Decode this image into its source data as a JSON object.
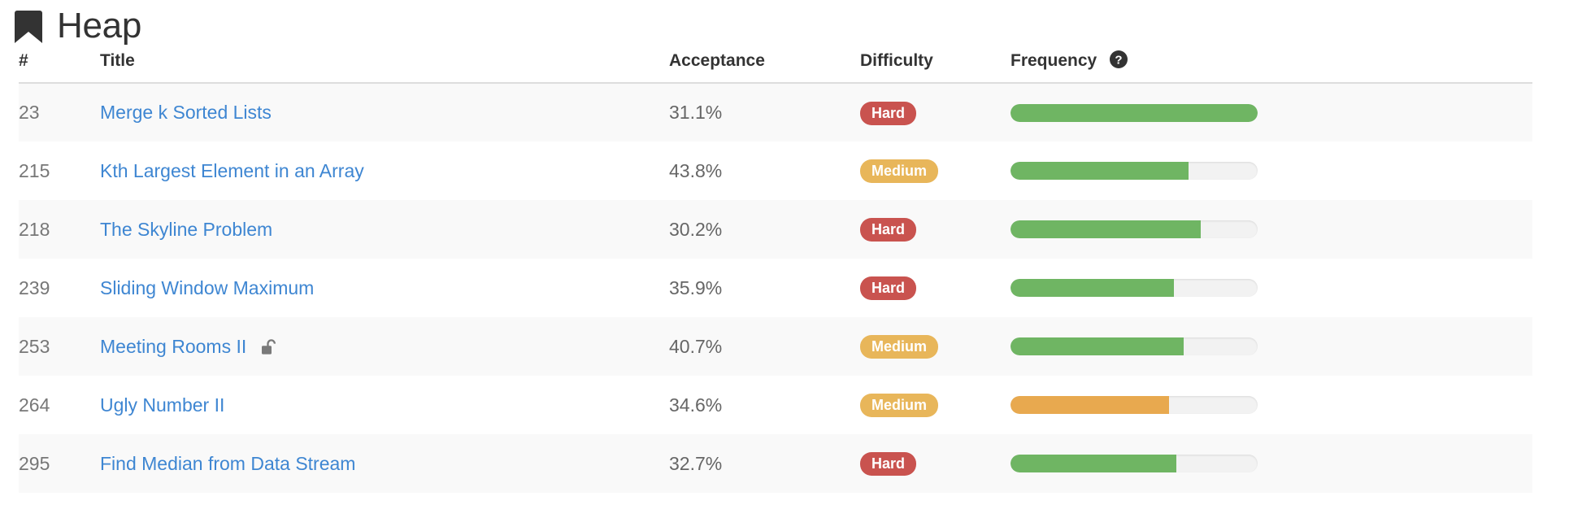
{
  "header": {
    "title": "Heap",
    "bookmark_icon": "bookmark-icon"
  },
  "table": {
    "columns": {
      "id": "#",
      "title": "Title",
      "acceptance": "Acceptance",
      "difficulty": "Difficulty",
      "frequency": "Frequency"
    },
    "frequency_help_icon": "question-circle-icon",
    "rows": [
      {
        "id": "23",
        "title": "Merge k Sorted Lists",
        "acceptance": "31.1%",
        "difficulty": "Hard",
        "difficulty_class": "badge-hard",
        "frequency_percent": 100,
        "frequency_color": "#6fb563",
        "locked": false
      },
      {
        "id": "215",
        "title": "Kth Largest Element in an Array",
        "acceptance": "43.8%",
        "difficulty": "Medium",
        "difficulty_class": "badge-medium",
        "frequency_percent": 72,
        "frequency_color": "#6fb563",
        "locked": false
      },
      {
        "id": "218",
        "title": "The Skyline Problem",
        "acceptance": "30.2%",
        "difficulty": "Hard",
        "difficulty_class": "badge-hard",
        "frequency_percent": 77,
        "frequency_color": "#6fb563",
        "locked": false
      },
      {
        "id": "239",
        "title": "Sliding Window Maximum",
        "acceptance": "35.9%",
        "difficulty": "Hard",
        "difficulty_class": "badge-hard",
        "frequency_percent": 66,
        "frequency_color": "#6fb563",
        "locked": false
      },
      {
        "id": "253",
        "title": "Meeting Rooms II",
        "acceptance": "40.7%",
        "difficulty": "Medium",
        "difficulty_class": "badge-medium",
        "frequency_percent": 70,
        "frequency_color": "#6fb563",
        "locked": true,
        "lock_icon": "unlock-icon"
      },
      {
        "id": "264",
        "title": "Ugly Number II",
        "acceptance": "34.6%",
        "difficulty": "Medium",
        "difficulty_class": "badge-medium",
        "frequency_percent": 64,
        "frequency_color": "#e8a94f",
        "locked": false
      },
      {
        "id": "295",
        "title": "Find Median from Data Stream",
        "acceptance": "32.7%",
        "difficulty": "Hard",
        "difficulty_class": "badge-hard",
        "frequency_percent": 67,
        "frequency_color": "#6fb563",
        "locked": false
      }
    ]
  },
  "colors": {
    "link": "#3e86d2",
    "hard": "#c9534f",
    "medium": "#e8b65a",
    "bar_green": "#6fb563",
    "bar_orange": "#e8a94f",
    "row_alt": "#f9f9f9",
    "text_muted": "#666666"
  }
}
